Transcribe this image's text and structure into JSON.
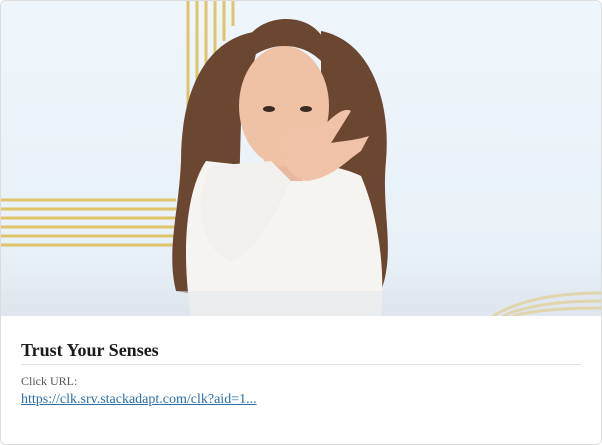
{
  "ad": {
    "image_alt": "Girl pinching her nose",
    "title": "Trust Your Senses",
    "url_label": "Click URL:",
    "url_text": "https://clk.srv.stackadapt.com/clk?aid=1..."
  },
  "colors": {
    "accent_lines": "#e0c46a",
    "link": "#2b6ea8",
    "title": "#1a1a1a"
  }
}
